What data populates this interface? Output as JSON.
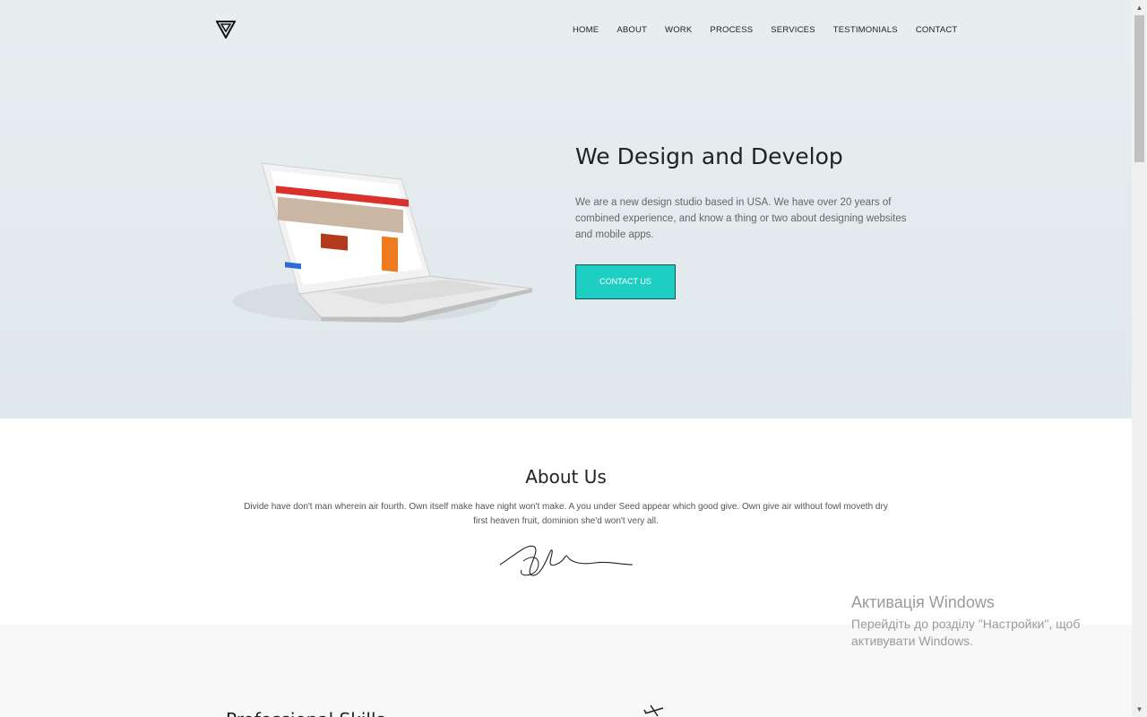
{
  "nav": {
    "items": [
      "HOME",
      "ABOUT",
      "WORK",
      "PROCESS",
      "SERVICES",
      "TESTIMONIALS",
      "CONTACT"
    ]
  },
  "hero": {
    "title": "We Design and Develop",
    "text": "We are a new design studio based in USA. We have over 20 years of combined experience, and know a thing or two about designing websites and mobile apps.",
    "cta_label": "CONTACT US"
  },
  "about": {
    "title": "About Us",
    "text": "Divide have don't man wherein air fourth. Own itself make have night won't make. A you under Seed appear which good give. Own give air without fowl moveth dry first heaven fruit, dominion she'd won't very all."
  },
  "skills": {
    "title": "Professional Skills"
  },
  "windows": {
    "title": "Активація Windows",
    "message": "Перейдіть до розділу \"Настройки\", щоб активувати Windows."
  },
  "colors": {
    "accent": "#1ccfc2",
    "hero_bg": "#e3ebee"
  },
  "icons": [
    "logo-triangle-icon",
    "laptop-image",
    "signature-image",
    "plane-icon",
    "scroll-up-icon",
    "scroll-down-icon"
  ]
}
